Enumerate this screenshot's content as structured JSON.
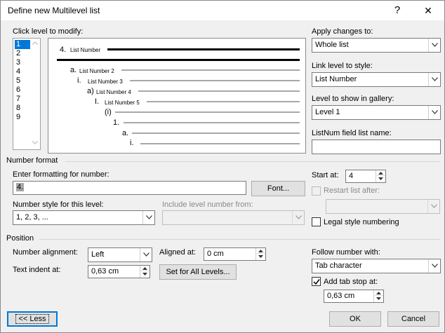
{
  "window": {
    "title": "Define new Multilevel list",
    "help_glyph": "?",
    "close_glyph": "✕"
  },
  "levels": {
    "label": "Click level to modify:",
    "items": [
      "1",
      "2",
      "3",
      "4",
      "5",
      "6",
      "7",
      "8",
      "9"
    ],
    "selected": "1"
  },
  "preview": {
    "rows": [
      {
        "num": "4.",
        "text": "List Number"
      },
      {
        "num": "a.",
        "text": "List Number 2"
      },
      {
        "num": "i.",
        "text": "List Number 3"
      },
      {
        "num": "a)",
        "text": "List Number 4"
      },
      {
        "num": "I.",
        "text": "List Number 5"
      },
      {
        "num": "(i)",
        "text": ""
      },
      {
        "num": "1.",
        "text": ""
      },
      {
        "num": "a.",
        "text": ""
      },
      {
        "num": "i.",
        "text": ""
      }
    ]
  },
  "right": {
    "apply_label": "Apply changes to:",
    "apply_value": "Whole list",
    "link_label": "Link level to style:",
    "link_value": "List Number",
    "gallery_label": "Level to show in gallery:",
    "gallery_value": "Level 1",
    "listnum_label": "ListNum field list name:",
    "listnum_value": ""
  },
  "number_format": {
    "section": "Number format",
    "enter_label": "Enter formatting for number:",
    "enter_value": "4.",
    "font_button": "Font...",
    "style_label": "Number style for this level:",
    "style_value": "1, 2, 3, ...",
    "include_label": "Include level number from:",
    "include_value": "",
    "start_label": "Start at:",
    "start_value": "4",
    "restart_label": "Restart list after:",
    "restart_value": "",
    "legal_label": "Legal style numbering"
  },
  "position": {
    "section": "Position",
    "alignment_label": "Number alignment:",
    "alignment_value": "Left",
    "aligned_at_label": "Aligned at:",
    "aligned_at_value": "0 cm",
    "indent_label": "Text indent at:",
    "indent_value": "0,63 cm",
    "set_all_button": "Set for All Levels...",
    "follow_label": "Follow number with:",
    "follow_value": "Tab character",
    "add_tab_label": "Add tab stop at:",
    "add_tab_checked": true,
    "tab_stop_value": "0,63 cm"
  },
  "footer": {
    "less_button": "<< Less",
    "ok_button": "OK",
    "cancel_button": "Cancel"
  }
}
